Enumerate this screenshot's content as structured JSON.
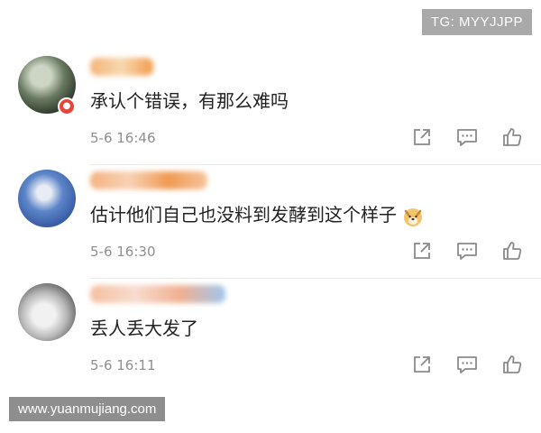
{
  "badge": {
    "text": "TG: MYYJJPP"
  },
  "watermark": {
    "text": "www.yuanmujiang.com"
  },
  "comments": [
    {
      "text": "承认个错误，有那么难吗",
      "time": "5-6 16:46"
    },
    {
      "text": "估计他们自己也没料到发酵到这个样子",
      "time": "5-6 16:30",
      "emoji": "doge-emoji"
    },
    {
      "text": "丢人丢大发了",
      "time": "5-6 16:11"
    }
  ],
  "icons": {
    "share": "share-icon",
    "reply": "comment-icon",
    "like": "thumbs-up-icon"
  },
  "colors": {
    "text": "#222222",
    "meta": "#8f8f8f",
    "vip": "#e8443a"
  }
}
